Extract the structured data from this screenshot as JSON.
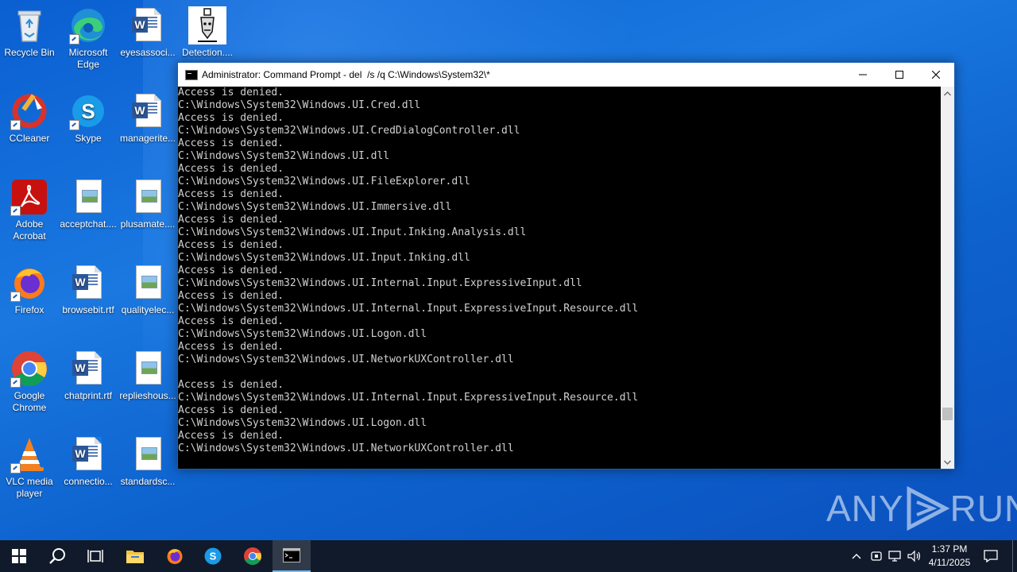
{
  "desktop": {
    "icons": [
      {
        "label": "Recycle Bin"
      },
      {
        "label": "Microsoft Edge"
      },
      {
        "label": "eyesassoci..."
      },
      {
        "label": "Detection...."
      },
      {
        "label": "CCleaner"
      },
      {
        "label": "Skype"
      },
      {
        "label": "managerite..."
      },
      {
        "label": "Adobe Acrobat"
      },
      {
        "label": "acceptchat...."
      },
      {
        "label": "plusamate...."
      },
      {
        "label": "Firefox"
      },
      {
        "label": "browsebit.rtf"
      },
      {
        "label": "qualityelec..."
      },
      {
        "label": "Google Chrome"
      },
      {
        "label": "chatprint.rtf"
      },
      {
        "label": "replieshous..."
      },
      {
        "label": "VLC media player"
      },
      {
        "label": "connectio..."
      },
      {
        "label": "standardsc..."
      }
    ]
  },
  "cmd_window": {
    "title": "Administrator: Command Prompt - del  /s /q C:\\Windows\\System32\\*",
    "lines": [
      "Access is denied.",
      "C:\\Windows\\System32\\Windows.UI.Cred.dll",
      "Access is denied.",
      "C:\\Windows\\System32\\Windows.UI.CredDialogController.dll",
      "Access is denied.",
      "C:\\Windows\\System32\\Windows.UI.dll",
      "Access is denied.",
      "C:\\Windows\\System32\\Windows.UI.FileExplorer.dll",
      "Access is denied.",
      "C:\\Windows\\System32\\Windows.UI.Immersive.dll",
      "Access is denied.",
      "C:\\Windows\\System32\\Windows.UI.Input.Inking.Analysis.dll",
      "Access is denied.",
      "C:\\Windows\\System32\\Windows.UI.Input.Inking.dll",
      "Access is denied.",
      "C:\\Windows\\System32\\Windows.UI.Internal.Input.ExpressiveInput.dll",
      "Access is denied.",
      "C:\\Windows\\System32\\Windows.UI.Internal.Input.ExpressiveInput.Resource.dll",
      "Access is denied.",
      "C:\\Windows\\System32\\Windows.UI.Logon.dll",
      "Access is denied.",
      "C:\\Windows\\System32\\Windows.UI.NetworkUXController.dll",
      "",
      "Access is denied.",
      "C:\\Windows\\System32\\Windows.UI.Internal.Input.ExpressiveInput.Resource.dll",
      "Access is denied.",
      "C:\\Windows\\System32\\Windows.UI.Logon.dll",
      "Access is denied.",
      "C:\\Windows\\System32\\Windows.UI.NetworkUXController.dll"
    ]
  },
  "watermark": {
    "text_left": "ANY",
    "text_right": "RUN"
  },
  "taskbar": {
    "clock_time": "1:37 PM",
    "clock_date": "4/11/2025"
  },
  "colors": {
    "desktop_blue": "#0a5fd1",
    "taskbar_bg": "#101a2a",
    "console_bg": "#000000",
    "console_text": "#d0d0d0"
  }
}
